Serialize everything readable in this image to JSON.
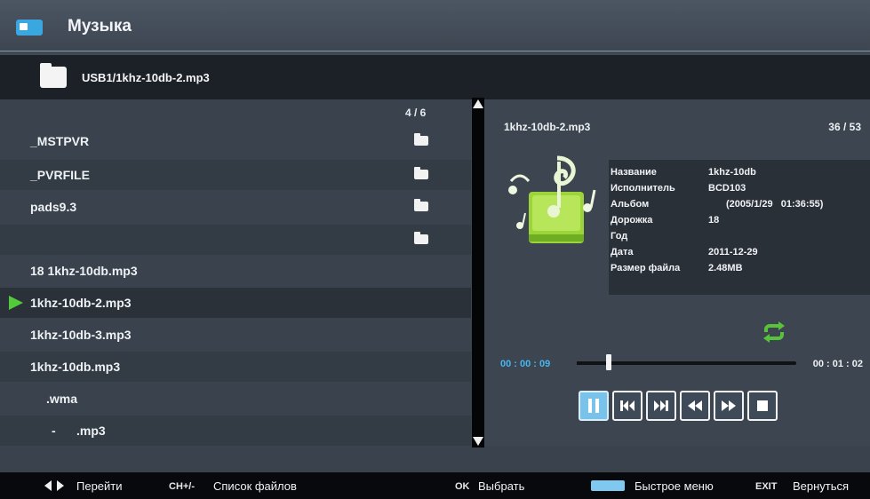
{
  "app": {
    "title": "Музыка",
    "icon": "music-folder-icon"
  },
  "path": {
    "text": "USB1/1khz-10db-2.mp3",
    "icon": "folder-icon"
  },
  "filelist": {
    "counter": "4 / 6",
    "items": [
      {
        "label": "_MSTPVR",
        "type": "folder"
      },
      {
        "label": "_PVRFILE",
        "type": "folder"
      },
      {
        "label": "pads9.3",
        "type": "folder"
      },
      {
        "label": "",
        "type": "folder"
      },
      {
        "label": "18 1khz-10db.mp3",
        "type": "file"
      },
      {
        "label": "1khz-10db-2.mp3",
        "type": "file",
        "selected": true
      },
      {
        "label": "1khz-10db-3.mp3",
        "type": "file"
      },
      {
        "label": "1khz-10db.mp3",
        "type": "file"
      },
      {
        "label": ".wma",
        "type": "file"
      },
      {
        "label": "-      .mp3",
        "type": "file"
      }
    ]
  },
  "info": {
    "filename": "1khz-10db-2.mp3",
    "counter": "36 / 53",
    "meta": [
      {
        "key": "Название",
        "value": "1khz-10db"
      },
      {
        "key": "Исполнитель",
        "value": "BCD103"
      },
      {
        "key": "Альбом",
        "value": "(2005/1/29   01:36:55)"
      },
      {
        "key": "Дорожка",
        "value": "18"
      },
      {
        "key": "Год",
        "value": ""
      },
      {
        "key": "Дата",
        "value": "2011-12-29"
      },
      {
        "key": "Размер файла",
        "value": "2.48MB"
      }
    ]
  },
  "player": {
    "time_current": "00 : 00 : 09",
    "time_total": "00 : 01 : 02",
    "progress_fraction": 0.145,
    "controls": [
      {
        "name": "pause-icon",
        "active": true
      },
      {
        "name": "previous-track-icon",
        "active": false
      },
      {
        "name": "next-track-icon",
        "active": false
      },
      {
        "name": "rewind-icon",
        "active": false
      },
      {
        "name": "fast-forward-icon",
        "active": false
      },
      {
        "name": "stop-icon",
        "active": false
      }
    ],
    "repeat_icon": "repeat-icon"
  },
  "help": {
    "navigate": "Перейти",
    "ch_key": "CH+/-",
    "file_list": "Список файлов",
    "ok_key": "OK",
    "select": "Выбрать",
    "quick_menu": "Быстрое меню",
    "exit_key": "EXIT",
    "back": "Вернуться"
  },
  "colors": {
    "accent_green": "#55c93c",
    "time_blue": "#48b6ef",
    "active_button": "#79c3ea",
    "repeat_green": "#58c23a"
  }
}
